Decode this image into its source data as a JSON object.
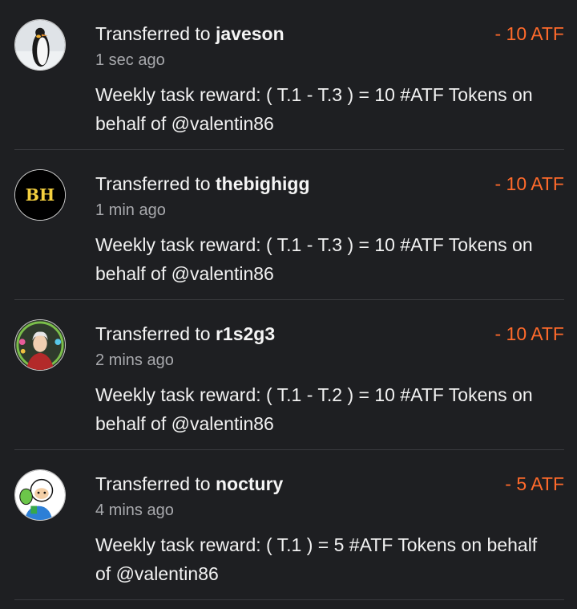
{
  "transfers": [
    {
      "prefix": "Transferred to ",
      "user": "javeson",
      "amount": "- 10 ATF",
      "time": "1 sec ago",
      "memo": "Weekly task reward: ( T.1 - T.3 ) = 10 #ATF Tokens on behalf of @valentin86",
      "avatar_icon": "penguin-avatar"
    },
    {
      "prefix": "Transferred to ",
      "user": "thebighigg",
      "amount": "- 10 ATF",
      "time": "1 min ago",
      "memo": "Weekly task reward: ( T.1 - T.3 ) = 10 #ATF Tokens on behalf of @valentin86",
      "avatar_icon": "bh-logo-avatar",
      "avatar_text": "BH"
    },
    {
      "prefix": "Transferred to ",
      "user": "r1s2g3",
      "amount": "- 10 ATF",
      "time": "2 mins ago",
      "memo": "Weekly task reward: ( T.1 - T.2 ) = 10 #ATF Tokens on behalf of @valentin86",
      "avatar_icon": "portrait-avatar"
    },
    {
      "prefix": "Transferred to ",
      "user": "noctury",
      "amount": "- 5 ATF",
      "time": "4 mins ago",
      "memo": "Weekly task reward: ( T.1 ) = 5 #ATF Tokens on behalf of @valentin86",
      "avatar_icon": "cartoon-avatar"
    }
  ],
  "colors": {
    "background": "#1e1f22",
    "amount": "#ff6a2b",
    "secondary_text": "#a8a9ad",
    "divider": "#3a3b3f",
    "bh_yellow": "#f4d03f"
  }
}
